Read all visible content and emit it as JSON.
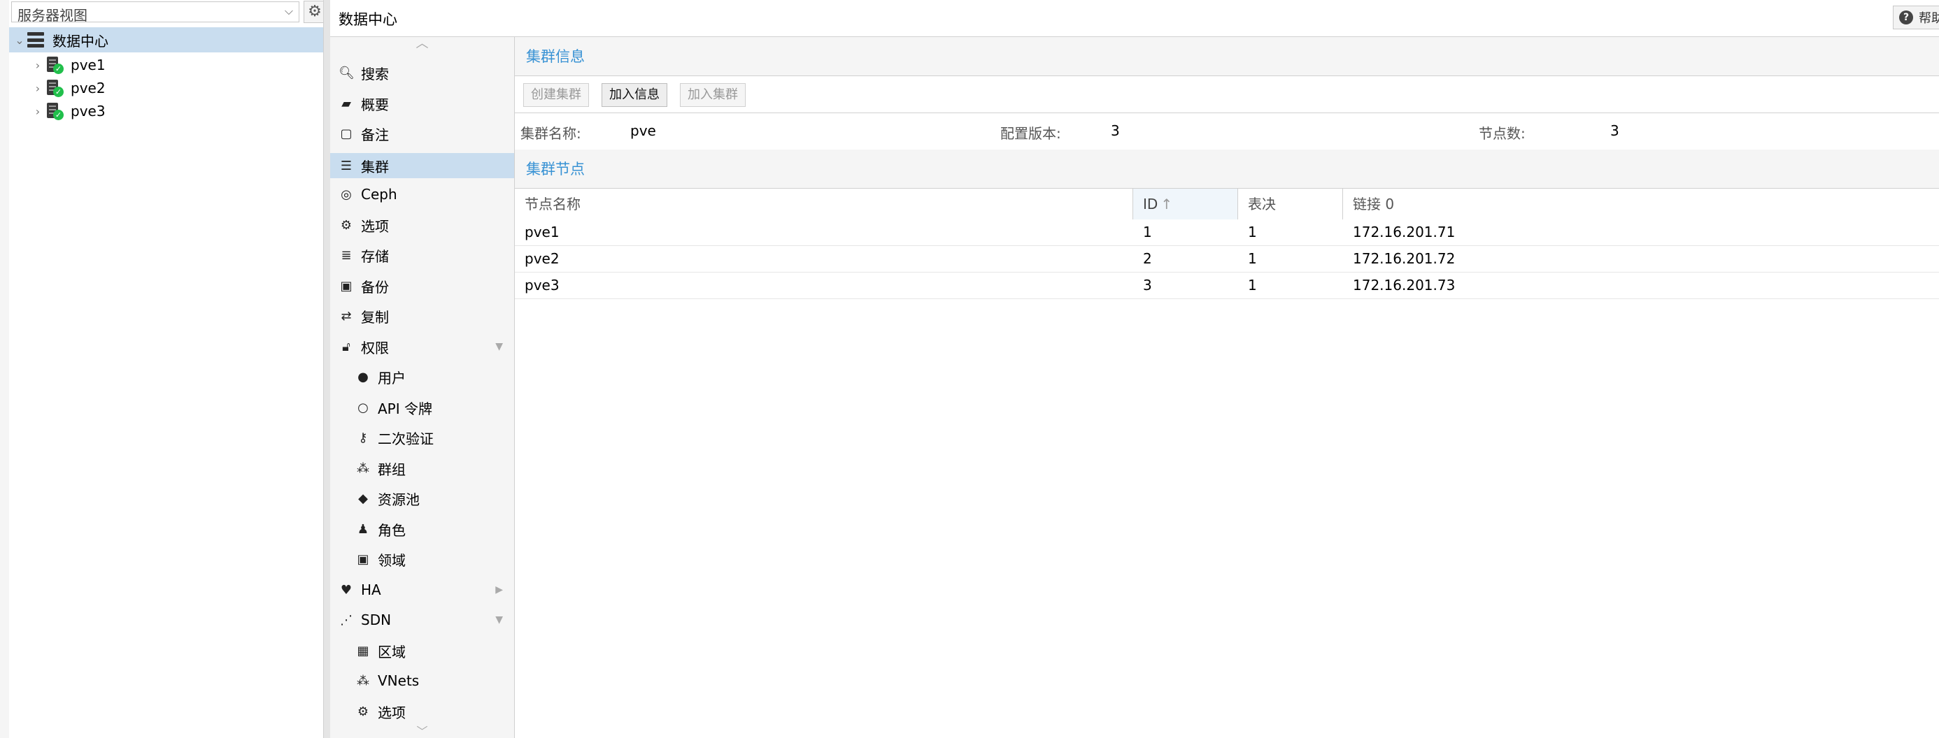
{
  "tree": {
    "view_selector": "服务器视图",
    "root": "数据中心",
    "nodes": [
      "pve1",
      "pve2",
      "pve3"
    ]
  },
  "header": {
    "title": "数据中心",
    "help_label": "帮助"
  },
  "menu": {
    "search": "搜索",
    "summary": "概要",
    "notes": "备注",
    "cluster": "集群",
    "ceph": "Ceph",
    "options": "选项",
    "storage": "存储",
    "backup": "备份",
    "replication": "复制",
    "permissions": "权限",
    "users": "用户",
    "api_tokens": "API 令牌",
    "two_factor": "二次验证",
    "groups": "群组",
    "pools": "资源池",
    "roles": "角色",
    "realms": "领域",
    "ha": "HA",
    "sdn": "SDN",
    "zones": "区域",
    "vnets": "VNets",
    "sdn_options": "选项"
  },
  "cluster_info": {
    "section_title": "集群信息",
    "create_button": "创建集群",
    "join_info_button": "加入信息",
    "join_button": "加入集群",
    "name_label": "集群名称:",
    "name_value": "pve",
    "config_version_label": "配置版本:",
    "config_version_value": "3",
    "node_count_label": "节点数:",
    "node_count_value": "3"
  },
  "cluster_nodes": {
    "section_title": "集群节点",
    "columns": {
      "name": "节点名称",
      "id": "ID",
      "votes": "表决",
      "link0": "链接 0"
    },
    "sort_arrow": "↑",
    "rows": [
      {
        "name": "pve1",
        "id": "1",
        "votes": "1",
        "link0": "172.16.201.71"
      },
      {
        "name": "pve2",
        "id": "2",
        "votes": "1",
        "link0": "172.16.201.72"
      },
      {
        "name": "pve3",
        "id": "3",
        "votes": "1",
        "link0": "172.16.201.73"
      }
    ]
  }
}
